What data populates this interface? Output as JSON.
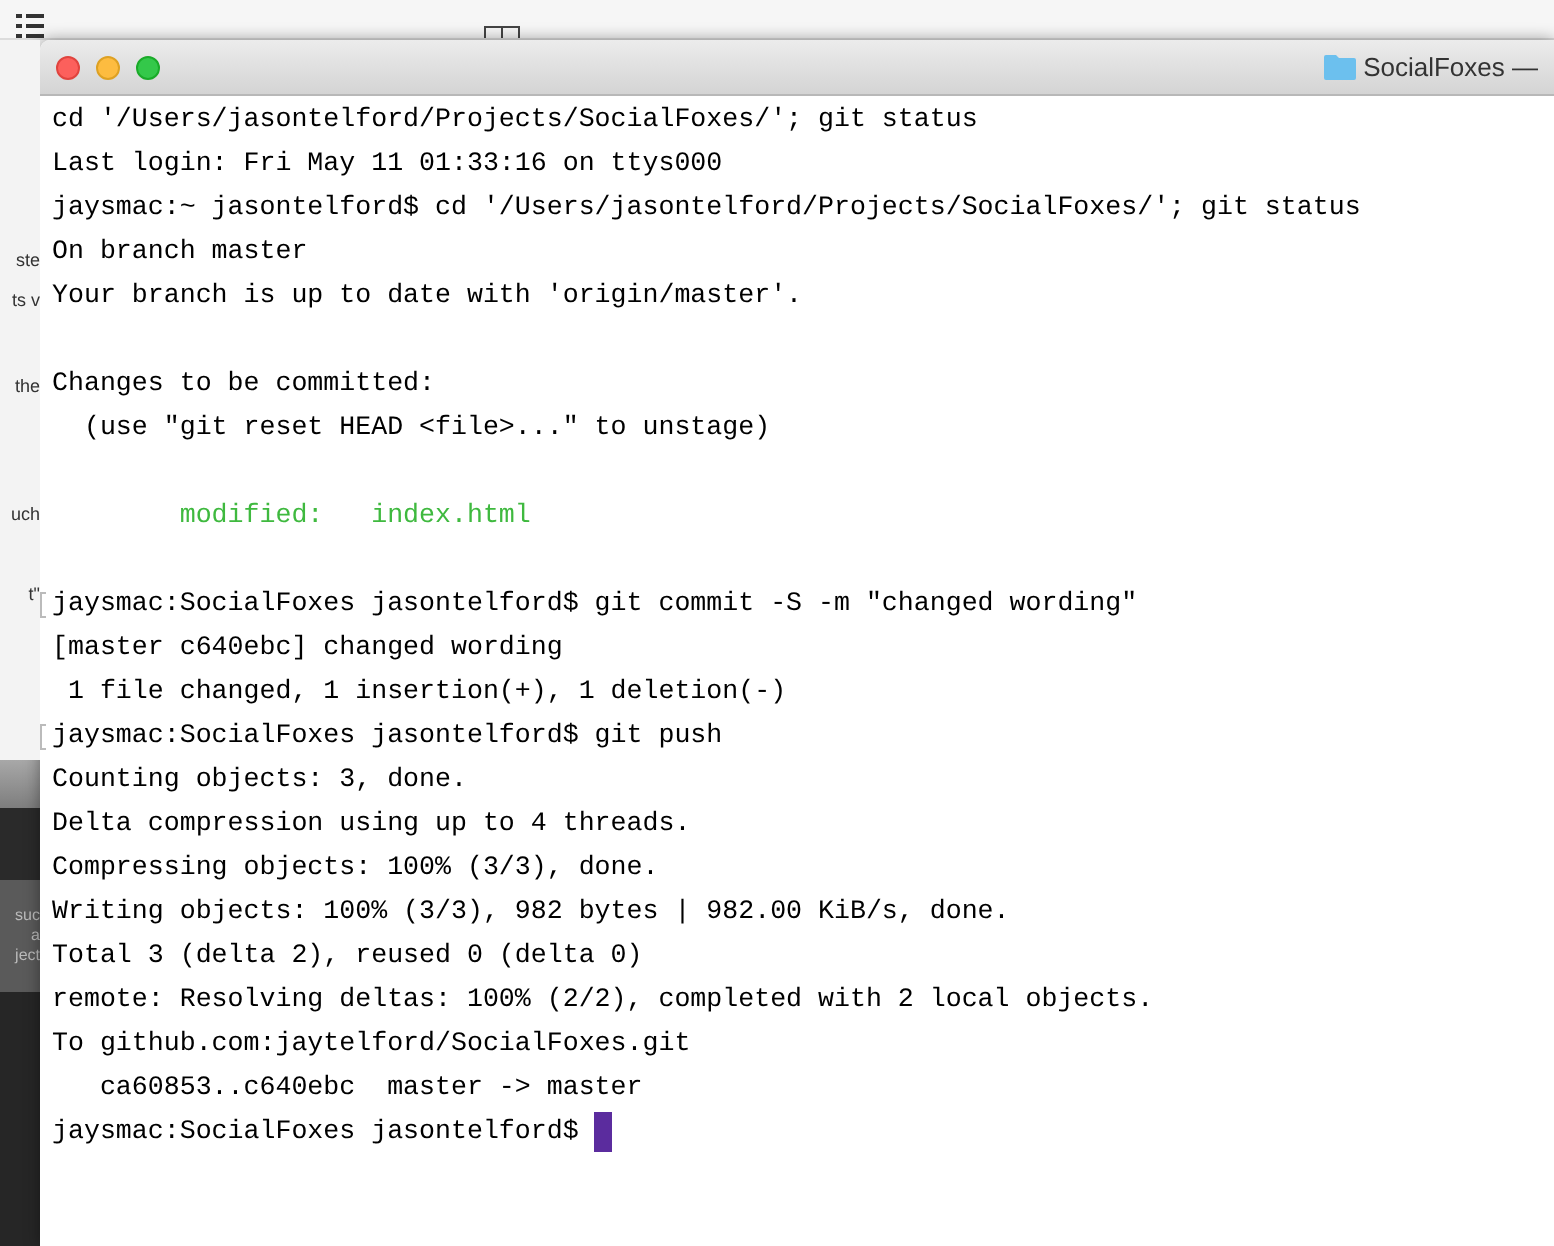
{
  "background_app": {
    "upper_texts": [
      "ste",
      "ts v",
      "the",
      "uch",
      "t\""
    ],
    "notification_texts": [
      "suc",
      "a",
      "ject"
    ]
  },
  "window": {
    "title": "SocialFoxes —"
  },
  "terminal": {
    "lines": [
      {
        "kind": "text",
        "text": "cd '/Users/jasontelford/Projects/SocialFoxes/'; git status",
        "marked": false
      },
      {
        "kind": "text",
        "text": "Last login: Fri May 11 01:33:16 on ttys000",
        "marked": false
      },
      {
        "kind": "text",
        "text": "jaysmac:~ jasontelford$ cd '/Users/jasontelford/Projects/SocialFoxes/'; git status",
        "marked": false
      },
      {
        "kind": "text",
        "text": "On branch master",
        "marked": false
      },
      {
        "kind": "text",
        "text": "Your branch is up to date with 'origin/master'.",
        "marked": false
      },
      {
        "kind": "blank"
      },
      {
        "kind": "text",
        "text": "Changes to be committed:",
        "marked": false
      },
      {
        "kind": "text",
        "text": "  (use \"git reset HEAD <file>...\" to unstage)",
        "marked": false
      },
      {
        "kind": "blank"
      },
      {
        "kind": "staged",
        "text": "        modified:   index.html",
        "marked": false
      },
      {
        "kind": "blank"
      },
      {
        "kind": "text",
        "text": "jaysmac:SocialFoxes jasontelford$ git commit -S -m \"changed wording\"",
        "marked": true
      },
      {
        "kind": "text",
        "text": "[master c640ebc] changed wording",
        "marked": false
      },
      {
        "kind": "text",
        "text": " 1 file changed, 1 insertion(+), 1 deletion(-)",
        "marked": false
      },
      {
        "kind": "text",
        "text": "jaysmac:SocialFoxes jasontelford$ git push",
        "marked": true
      },
      {
        "kind": "text",
        "text": "Counting objects: 3, done.",
        "marked": false
      },
      {
        "kind": "text",
        "text": "Delta compression using up to 4 threads.",
        "marked": false
      },
      {
        "kind": "text",
        "text": "Compressing objects: 100% (3/3), done.",
        "marked": false
      },
      {
        "kind": "text",
        "text": "Writing objects: 100% (3/3), 982 bytes | 982.00 KiB/s, done.",
        "marked": false
      },
      {
        "kind": "text",
        "text": "Total 3 (delta 2), reused 0 (delta 0)",
        "marked": false
      },
      {
        "kind": "text",
        "text": "remote: Resolving deltas: 100% (2/2), completed with 2 local objects.",
        "marked": false
      },
      {
        "kind": "text",
        "text": "To github.com:jaytelford/SocialFoxes.git",
        "marked": false
      },
      {
        "kind": "text",
        "text": "   ca60853..c640ebc  master -> master",
        "marked": false
      },
      {
        "kind": "prompt",
        "text": "jaysmac:SocialFoxes jasontelford$ ",
        "marked": false
      }
    ]
  }
}
